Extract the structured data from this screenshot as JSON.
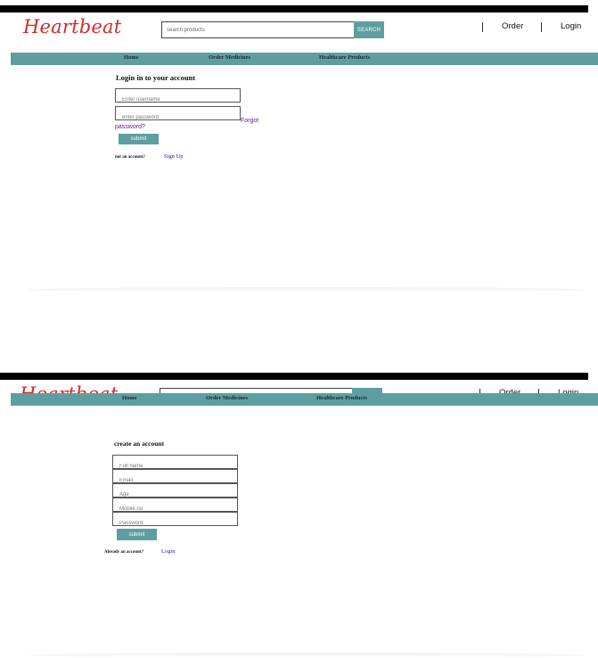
{
  "brand": {
    "logo": "Heartbeat",
    "logo_color": "#d42a2a",
    "accent": "#5f9ea0"
  },
  "header": {
    "search_placeholder": "search products",
    "search_button": "SEARCH",
    "links": {
      "order": "Order",
      "login": "Login"
    }
  },
  "nav": {
    "items": [
      "Home",
      "Order Medicines",
      "Healthcare Products"
    ]
  },
  "login": {
    "title": "Login in to your account",
    "username_placeholder": "Enter username",
    "password_placeholder": "enter password",
    "forgot_line1": "Forgot",
    "forgot_line2": "password?",
    "submit": "submit",
    "no_account": "not an account?",
    "signup_link": "Sign Up"
  },
  "register": {
    "title": "create an account",
    "fields": [
      "Full name",
      "Email",
      "Age",
      "Mobile.no",
      "Password"
    ],
    "submit": "submit",
    "already": "Already an account?",
    "login_link": "Login"
  }
}
